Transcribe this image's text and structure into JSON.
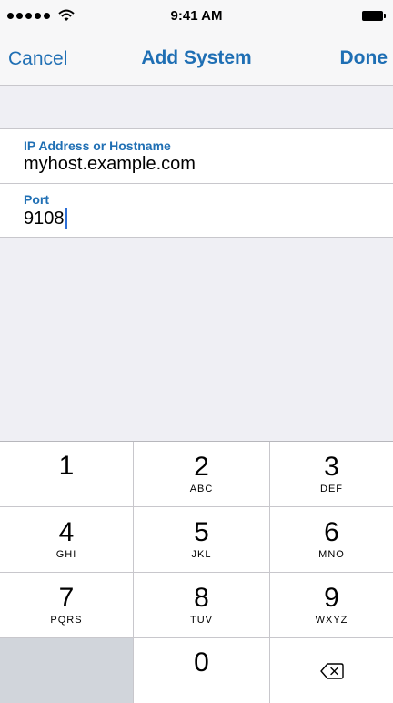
{
  "status_bar": {
    "time": "9:41 AM",
    "icons": [
      "signal-dots-icon",
      "wifi-icon",
      "battery-icon"
    ]
  },
  "nav": {
    "cancel_label": "Cancel",
    "title": "Add System",
    "done_label": "Done"
  },
  "form": {
    "host": {
      "label": "IP Address or Hostname",
      "value": "myhost.example.com"
    },
    "port": {
      "label": "Port",
      "value": "9108"
    }
  },
  "keypad": {
    "keys": [
      {
        "number": "1",
        "letters": ""
      },
      {
        "number": "2",
        "letters": "ABC"
      },
      {
        "number": "3",
        "letters": "DEF"
      },
      {
        "number": "4",
        "letters": "GHI"
      },
      {
        "number": "5",
        "letters": "JKL"
      },
      {
        "number": "6",
        "letters": "MNO"
      },
      {
        "number": "7",
        "letters": "PQRS"
      },
      {
        "number": "8",
        "letters": "TUV"
      },
      {
        "number": "9",
        "letters": "WXYZ"
      },
      {
        "number": "0",
        "letters": ""
      }
    ],
    "delete_icon": "backspace-icon"
  },
  "colors": {
    "accent": "#1f6fb4",
    "background": "#efeff4",
    "caret": "#2d6fd6",
    "blank_key": "#d1d5db"
  }
}
